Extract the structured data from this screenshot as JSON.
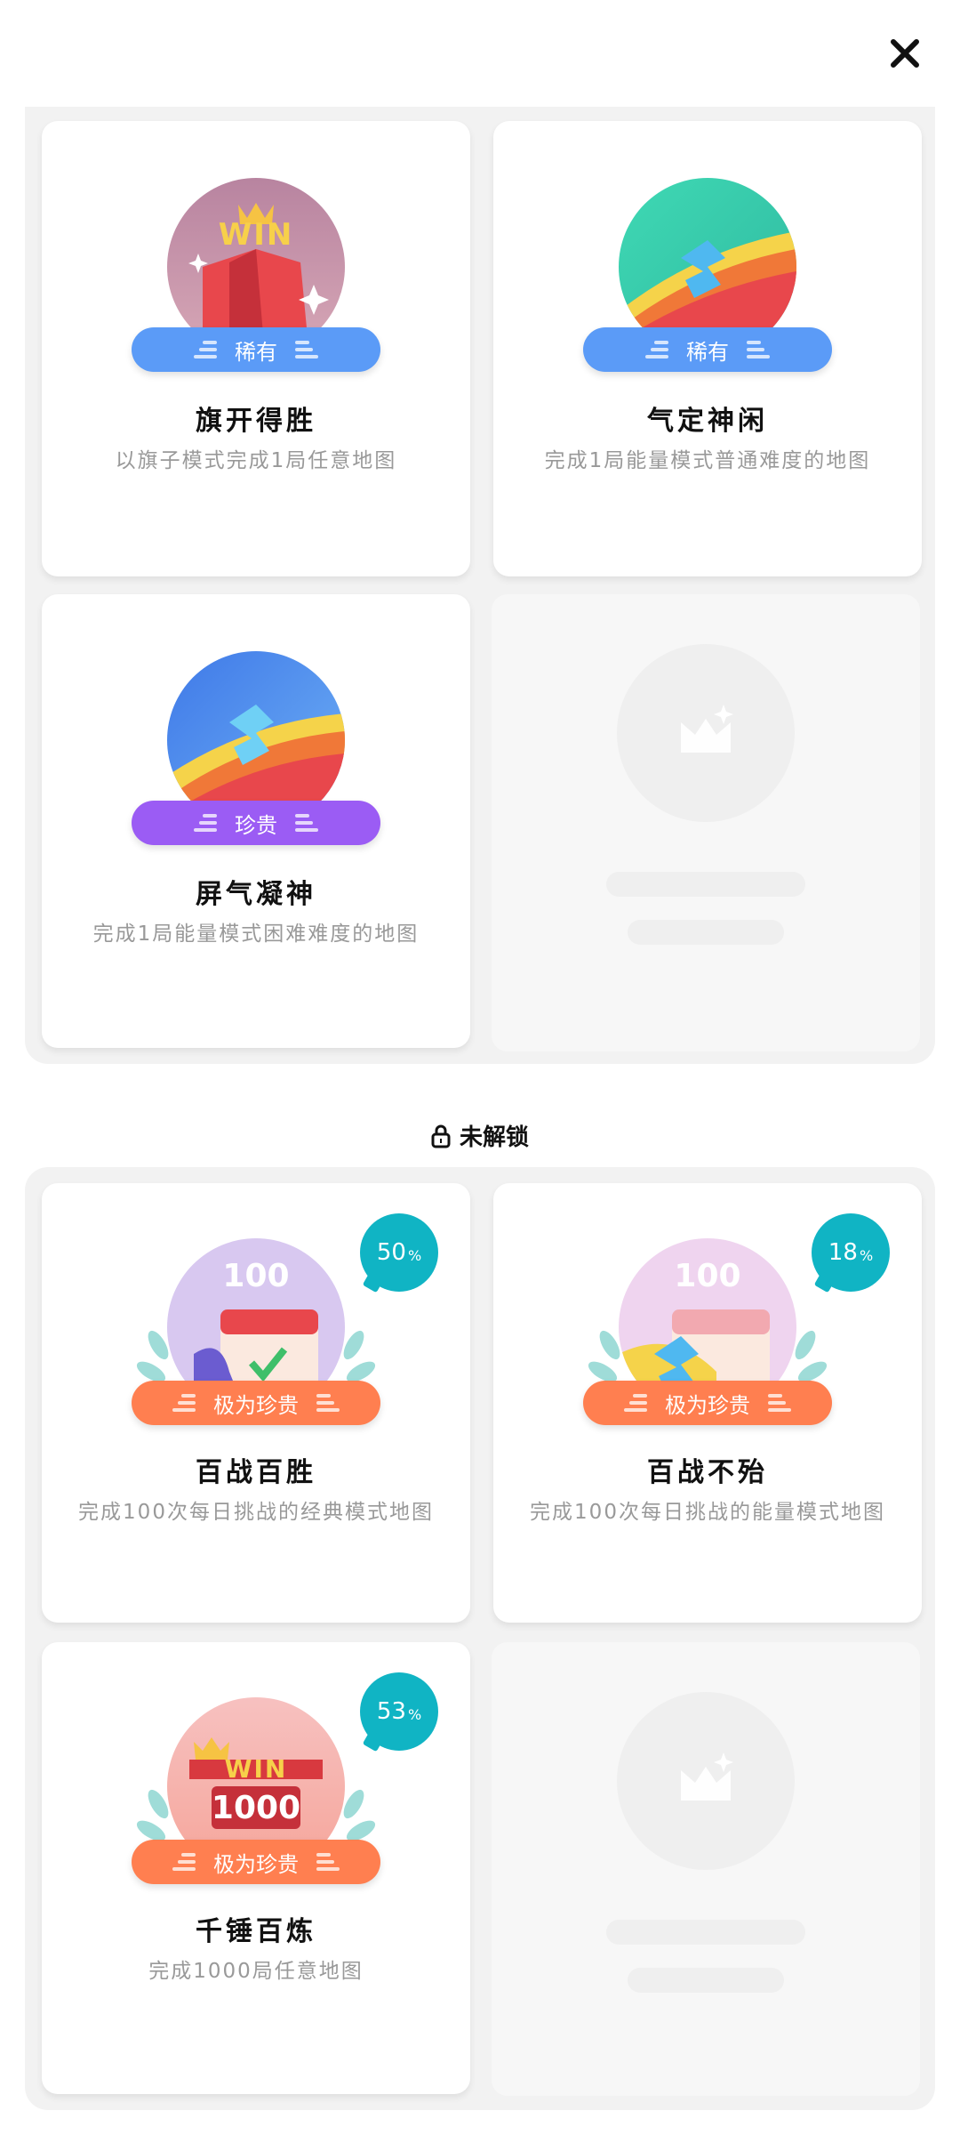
{
  "header": {
    "close_icon": "close-icon"
  },
  "unlocked": {
    "cards": [
      {
        "title": "旗开得胜",
        "desc": "以旗子模式完成1局任意地图",
        "rarity": "稀有",
        "rarity_color": "#5b9bf7",
        "icon": "flag-win-badge-icon"
      },
      {
        "title": "气定神闲",
        "desc": "完成1局能量模式普通难度的地图",
        "rarity": "稀有",
        "rarity_color": "#5b9bf7",
        "icon": "energy-normal-badge-icon"
      },
      {
        "title": "屏气凝神",
        "desc": "完成1局能量模式困难难度的地图",
        "rarity": "珍贵",
        "rarity_color": "#9b5cf4",
        "icon": "energy-hard-badge-icon"
      }
    ]
  },
  "locked_section": {
    "label": "未解锁",
    "icon": "lock-icon"
  },
  "locked": {
    "cards": [
      {
        "title": "百战百胜",
        "desc": "完成100次每日挑战的经典模式地图",
        "rarity": "极为珍贵",
        "rarity_color": "#ff7f50",
        "progress": "50",
        "progress_unit": "%",
        "icon": "daily-classic-100-badge-icon"
      },
      {
        "title": "百战不殆",
        "desc": "完成100次每日挑战的能量模式地图",
        "rarity": "极为珍贵",
        "rarity_color": "#ff7f50",
        "progress": "18",
        "progress_unit": "%",
        "icon": "daily-energy-100-badge-icon"
      },
      {
        "title": "千锤百炼",
        "desc": "完成1000局任意地图",
        "rarity": "极为珍贵",
        "rarity_color": "#ff7f50",
        "progress": "53",
        "progress_unit": "%",
        "icon": "win-1000-badge-icon"
      }
    ]
  },
  "badge_texts": {
    "win": "WIN",
    "hundred": "100",
    "thousand": "1000"
  }
}
